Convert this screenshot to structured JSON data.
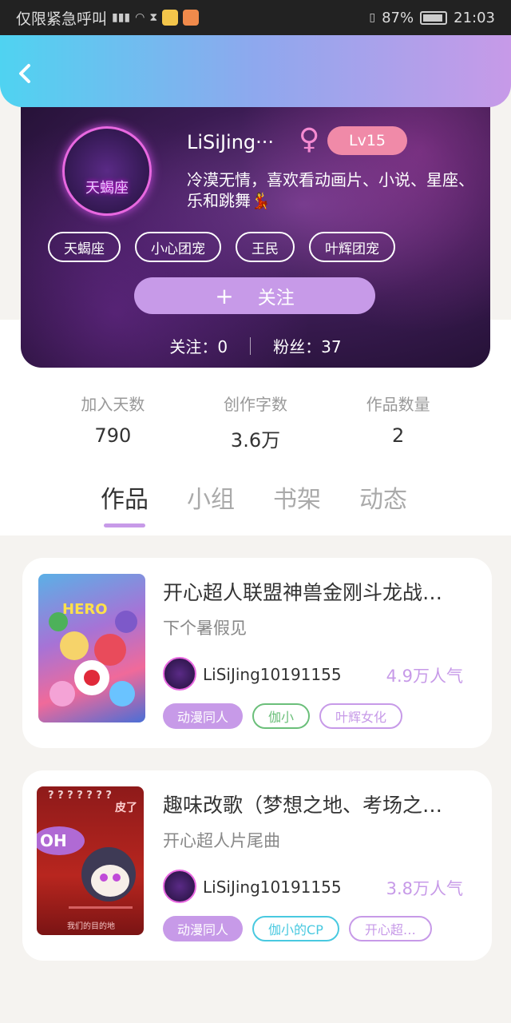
{
  "statusbar": {
    "carrier": "仅限紧急呼叫",
    "battery_percent": "87%",
    "time": "21:03"
  },
  "colors": {
    "accent": "#c79ae8",
    "header_gradient_start": "#4fd3f1",
    "header_gradient_end": "#c79ae8"
  },
  "header": {
    "back_icon": "chevron-left-icon"
  },
  "profile": {
    "avatar_text": "天蝎座",
    "username": "LiSiJing···",
    "gender_symbol": "♀",
    "level": "Lv15",
    "bio": "冷漠无情，喜欢看动画片、小说、星座、\n乐和跳舞💃",
    "tags": [
      "天蝎座",
      "小心团宠",
      "王民",
      "叶辉团宠"
    ],
    "follow_plus": "+",
    "follow_label": "关注",
    "following": "关注：0",
    "fans": "粉丝：37"
  },
  "stats": [
    {
      "label": "加入天数",
      "value": "790"
    },
    {
      "label": "创作字数",
      "value": "3.6万"
    },
    {
      "label": "作品数量",
      "value": "2"
    }
  ],
  "tabs": [
    "作品",
    "小组",
    "书架",
    "动态"
  ],
  "works": [
    {
      "title": "开心超人联盟神兽金刚斗龙战…",
      "subtitle": "下个暑假见",
      "author": "LiSiJing10191155",
      "popularity": "4.9万人气",
      "tags": [
        "动漫同人",
        "伽小",
        "叶辉女化"
      ],
      "cover_text": "HERO"
    },
    {
      "title": "趣味改歌（梦想之地、考场之…",
      "subtitle": "开心超人片尾曲",
      "author": "LiSiJing10191155",
      "popularity": "3.8万人气",
      "tags": [
        "动漫同人",
        "伽小的CP",
        "开心超…"
      ],
      "cover_text_top": "? ? ? ? ? ? ?",
      "cover_text_right": "皮了",
      "cover_text_left": "OH",
      "cover_text_bottom": "我们的目的地"
    }
  ]
}
